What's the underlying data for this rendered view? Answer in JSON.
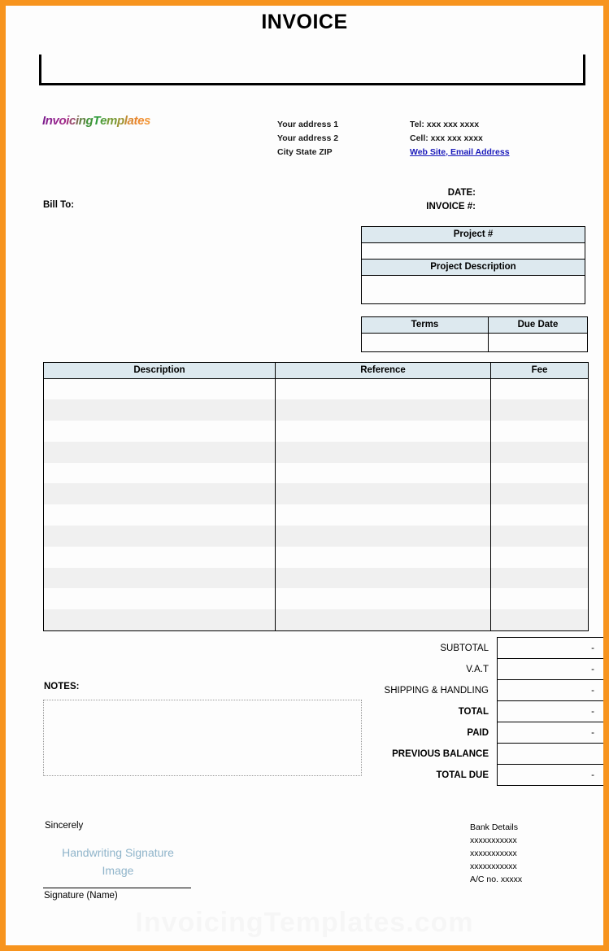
{
  "document": {
    "title": "INVOICE",
    "border_color": "#f7941e",
    "header_fill": "#dde9ef",
    "stripe_fill": "#f0f0f0",
    "link_color": "#1b1bbb",
    "signature_placeholder_color": "#8fb4ca"
  },
  "logo": {
    "text": "InvoicingTemplates",
    "letters": [
      {
        "ch": "I",
        "color": "#7d1f8e"
      },
      {
        "ch": "n",
        "color": "#8a2390"
      },
      {
        "ch": "v",
        "color": "#95268f"
      },
      {
        "ch": "o",
        "color": "#9f2a8a"
      },
      {
        "ch": "i",
        "color": "#a63280"
      },
      {
        "ch": "c",
        "color": "#9a4a6e"
      },
      {
        "ch": "i",
        "color": "#7f6a52"
      },
      {
        "ch": "n",
        "color": "#5f8140"
      },
      {
        "ch": "g",
        "color": "#3f9337"
      },
      {
        "ch": "T",
        "color": "#2e9b3a"
      },
      {
        "ch": "e",
        "color": "#4f9c38"
      },
      {
        "ch": "m",
        "color": "#789a36"
      },
      {
        "ch": "p",
        "color": "#9c9434"
      },
      {
        "ch": "l",
        "color": "#c08c32"
      },
      {
        "ch": "a",
        "color": "#d9862f"
      },
      {
        "ch": "t",
        "color": "#e8852c"
      },
      {
        "ch": "e",
        "color": "#ef8a2d"
      },
      {
        "ch": "s",
        "color": "#f39a3d"
      }
    ]
  },
  "company_address": {
    "line1": "Your address 1",
    "line2": "Your address 2",
    "line3": "City State ZIP"
  },
  "company_contact": {
    "tel": "Tel: xxx xxx xxxx",
    "cell": "Cell: xxx xxx xxxx",
    "web": "Web Site, Email Address"
  },
  "bill_to": {
    "label": "Bill To:",
    "value": ""
  },
  "meta": {
    "date_label": "DATE:",
    "date_value": "",
    "invoice_label": "INVOICE #:",
    "invoice_value": ""
  },
  "project_table": {
    "number_header": "Project #",
    "number_value": "",
    "description_header": "Project Description",
    "description_value": ""
  },
  "terms_table": {
    "headers": [
      "Terms",
      "Due Date"
    ],
    "values": [
      "",
      ""
    ]
  },
  "items_table": {
    "headers": [
      "Description",
      "Reference",
      "Fee"
    ],
    "row_count": 12,
    "rows": [
      {
        "description": "",
        "reference": "",
        "fee": ""
      },
      {
        "description": "",
        "reference": "",
        "fee": ""
      },
      {
        "description": "",
        "reference": "",
        "fee": ""
      },
      {
        "description": "",
        "reference": "",
        "fee": ""
      },
      {
        "description": "",
        "reference": "",
        "fee": ""
      },
      {
        "description": "",
        "reference": "",
        "fee": ""
      },
      {
        "description": "",
        "reference": "",
        "fee": ""
      },
      {
        "description": "",
        "reference": "",
        "fee": ""
      },
      {
        "description": "",
        "reference": "",
        "fee": ""
      },
      {
        "description": "",
        "reference": "",
        "fee": ""
      },
      {
        "description": "",
        "reference": "",
        "fee": ""
      },
      {
        "description": "",
        "reference": "",
        "fee": ""
      }
    ]
  },
  "totals": [
    {
      "label": "SUBTOTAL",
      "value": "-",
      "bold": false
    },
    {
      "label": "V.A.T",
      "value": "-",
      "bold": false
    },
    {
      "label": "SHIPPING & HANDLING",
      "value": "-",
      "bold": false
    },
    {
      "label": "TOTAL",
      "value": "-",
      "bold": true
    },
    {
      "label": "PAID",
      "value": "-",
      "bold": true
    },
    {
      "label": "PREVIOUS BALANCE",
      "value": "",
      "bold": true
    },
    {
      "label": "TOTAL DUE",
      "value": "-",
      "bold": true
    }
  ],
  "notes": {
    "label": "NOTES:",
    "value": ""
  },
  "signature": {
    "sincerely": "Sincerely",
    "placeholder_line1": "Handwriting Signature",
    "placeholder_line2": "Image",
    "name_label": "Signature (Name)"
  },
  "bank_details": {
    "title": "Bank Details",
    "lines": [
      "xxxxxxxxxxx",
      "xxxxxxxxxxx",
      "xxxxxxxxxxx",
      "A/C no. xxxxx"
    ]
  },
  "watermark": {
    "text": "InvoicingTemplates.com"
  }
}
